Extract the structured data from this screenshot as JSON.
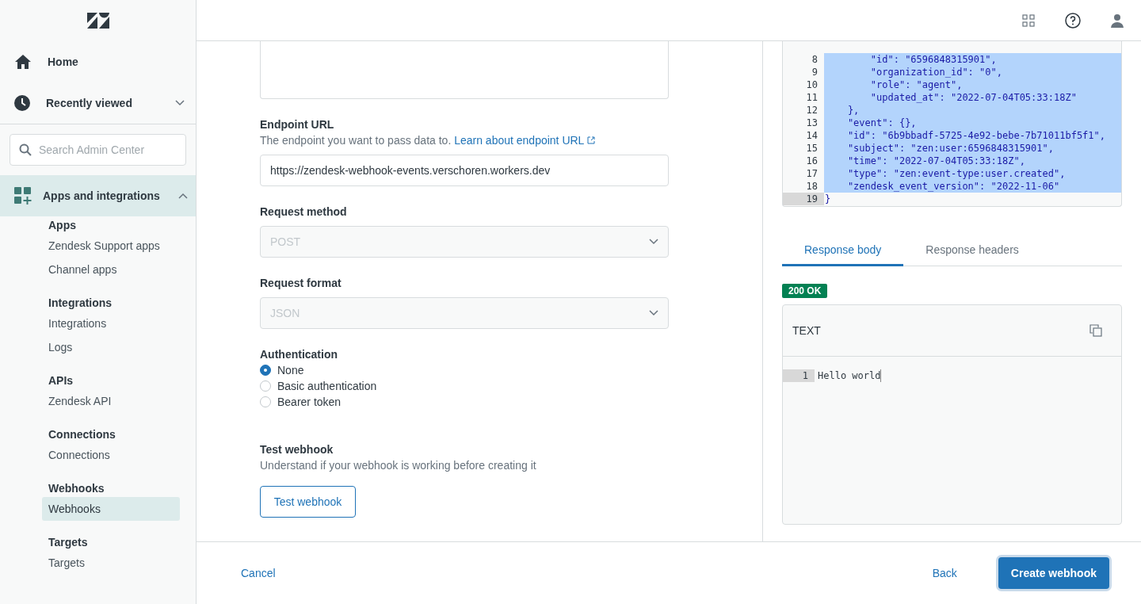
{
  "sidebar": {
    "top_items": [
      {
        "label": "Home",
        "kind": "home"
      },
      {
        "label": "Recently viewed",
        "kind": "recent",
        "expanded": false
      }
    ],
    "search": {
      "placeholder": "Search Admin Center"
    },
    "section": {
      "label": "Apps and integrations",
      "expanded": true
    },
    "groups": [
      {
        "title": "Apps",
        "items": [
          {
            "label": "Zendesk Support apps",
            "selected": false
          },
          {
            "label": "Channel apps",
            "selected": false
          }
        ]
      },
      {
        "title": "Integrations",
        "items": [
          {
            "label": "Integrations",
            "selected": false
          },
          {
            "label": "Logs",
            "selected": false
          }
        ]
      },
      {
        "title": "APIs",
        "items": [
          {
            "label": "Zendesk API",
            "selected": false
          }
        ]
      },
      {
        "title": "Connections",
        "items": [
          {
            "label": "Connections",
            "selected": false
          }
        ]
      },
      {
        "title": "Webhooks",
        "items": [
          {
            "label": "Webhooks",
            "selected": true
          }
        ]
      },
      {
        "title": "Targets",
        "items": [
          {
            "label": "Targets",
            "selected": false
          }
        ]
      }
    ]
  },
  "form": {
    "endpoint": {
      "label": "Endpoint URL",
      "hint": "The endpoint you want to pass data to.",
      "link": "Learn about endpoint URL",
      "value": "https://zendesk-webhook-events.verschoren.workers.dev"
    },
    "selects": [
      {
        "label": "Request method",
        "value": "POST",
        "disabled": true
      },
      {
        "label": "Request format",
        "value": "JSON",
        "disabled": true
      }
    ],
    "authentication": {
      "label": "Authentication",
      "options": [
        {
          "label": "None",
          "selected": true
        },
        {
          "label": "Basic authentication",
          "selected": false
        },
        {
          "label": "Bearer token",
          "selected": false
        }
      ]
    },
    "test": {
      "title": "Test webhook",
      "description": "Understand if your webhook is working before creating it",
      "button": "Test webhook"
    }
  },
  "request_editor": {
    "lines": [
      {
        "number": "8",
        "text": "        \"id\": \"6596848315901\",",
        "selected": true,
        "current": false
      },
      {
        "number": "9",
        "text": "        \"organization_id\": \"0\",",
        "selected": true,
        "current": false
      },
      {
        "number": "10",
        "text": "        \"role\": \"agent\",",
        "selected": true,
        "current": false
      },
      {
        "number": "11",
        "text": "        \"updated_at\": \"2022-07-04T05:33:18Z\"",
        "selected": true,
        "current": false
      },
      {
        "number": "12",
        "text": "    },",
        "selected": true,
        "current": false
      },
      {
        "number": "13",
        "text": "    \"event\": {},",
        "selected": true,
        "current": false
      },
      {
        "number": "14",
        "text": "    \"id\": \"6b9bbadf-5725-4e92-bebe-7b71011bf5f1\",",
        "selected": true,
        "current": false
      },
      {
        "number": "15",
        "text": "    \"subject\": \"zen:user:6596848315901\",",
        "selected": true,
        "current": false
      },
      {
        "number": "16",
        "text": "    \"time\": \"2022-07-04T05:33:18Z\",",
        "selected": true,
        "current": false
      },
      {
        "number": "17",
        "text": "    \"type\": \"zen:event-type:user.created\",",
        "selected": true,
        "current": false
      },
      {
        "number": "18",
        "text": "    \"zendesk_event_version\": \"2022-11-06\"",
        "selected": true,
        "current": false
      },
      {
        "number": "19",
        "text": "}",
        "selected": false,
        "current": true
      }
    ]
  },
  "response": {
    "tabs": [
      {
        "label": "Response body",
        "selected": true
      },
      {
        "label": "Response headers",
        "selected": false
      }
    ],
    "status": "200 OK",
    "format": "TEXT",
    "lines": [
      {
        "number": "1",
        "text": "Hello world"
      }
    ]
  },
  "footer": {
    "cancel": "Cancel",
    "back": "Back",
    "create": "Create webhook"
  }
}
